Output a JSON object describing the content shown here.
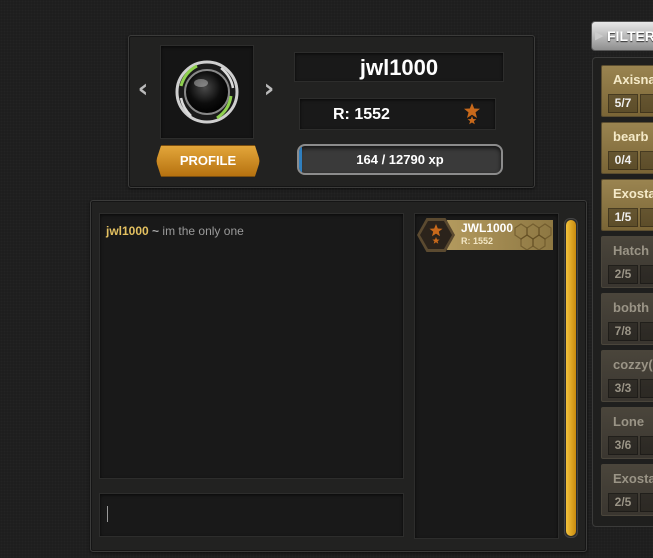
{
  "profile": {
    "prev_arrow": "‹",
    "next_arrow": "›",
    "profile_button": "PROFILE",
    "username": "jwl1000",
    "rating_text": "R: 1552",
    "xp_text": "164 / 12790 xp",
    "xp_fraction": 0.0128
  },
  "chat": {
    "messages": [
      {
        "user": "jwl1000",
        "separator": "~",
        "text": "im the only one"
      }
    ],
    "input_value": ""
  },
  "players": [
    {
      "name": "JWL1000",
      "rating": "R: 1552"
    }
  ],
  "filter": {
    "label": "FILTER"
  },
  "games": [
    {
      "name": "Axisna",
      "count": "5/7",
      "active": true
    },
    {
      "name": "bearb",
      "count": "0/4",
      "active": true
    },
    {
      "name": "Exosta",
      "count": "1/5",
      "active": true
    },
    {
      "name": "Hatch",
      "count": "2/5",
      "active": false
    },
    {
      "name": "bobth",
      "count": "7/8",
      "active": false
    },
    {
      "name": "cozzy(",
      "count": "3/3",
      "active": false
    },
    {
      "name": "Lone",
      "count": "3/6",
      "active": false
    },
    {
      "name": "Exosta",
      "count": "2/5",
      "active": false
    }
  ],
  "colors": {
    "accent_gold": "#e3a63a",
    "xp_blue": "#2f7fbf",
    "rank_orange": "#c8691b",
    "chat_username": "#e3c060"
  },
  "icons": {
    "prev": "chevron-left-icon",
    "next": "chevron-right-icon",
    "avatar": "avatar-orb-icon",
    "rank": "rank-stars-icon"
  }
}
